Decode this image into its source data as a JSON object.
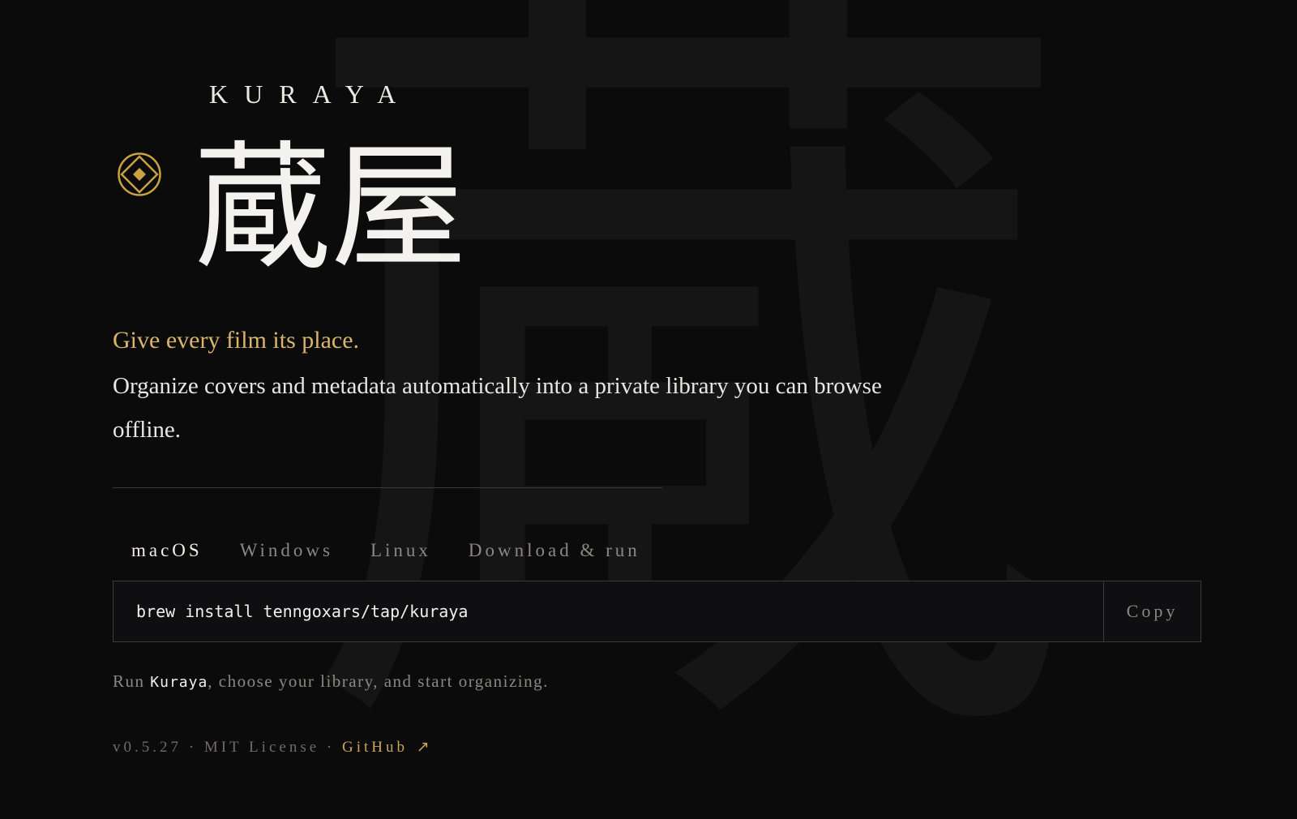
{
  "background": {
    "glyph": "蔵"
  },
  "brand": {
    "latin": "KURAYA",
    "kanji": "蔵屋",
    "logo_icon": "diamond-emblem-icon",
    "accent_color": "#d9b56a"
  },
  "hero": {
    "tagline": "Give every film its place.",
    "description": "Organize covers and metadata automatically into a private library you can browse offline."
  },
  "install": {
    "tabs": [
      {
        "label": "macOS",
        "active": true
      },
      {
        "label": "Windows",
        "active": false
      },
      {
        "label": "Linux",
        "active": false
      },
      {
        "label": "Download & run",
        "active": false
      }
    ],
    "command": "brew install tenngoxars/tap/kuraya",
    "copy_label": "Copy"
  },
  "run_note": {
    "prefix": "Run ",
    "app_name": "Kuraya",
    "suffix": ", choose your library, and start organizing."
  },
  "footer": {
    "version": "v0.5.27",
    "separator": " · ",
    "license": "MIT License",
    "github_label": "GitHub",
    "github_icon": "external-arrow-icon",
    "arrow_glyph": "↗"
  }
}
